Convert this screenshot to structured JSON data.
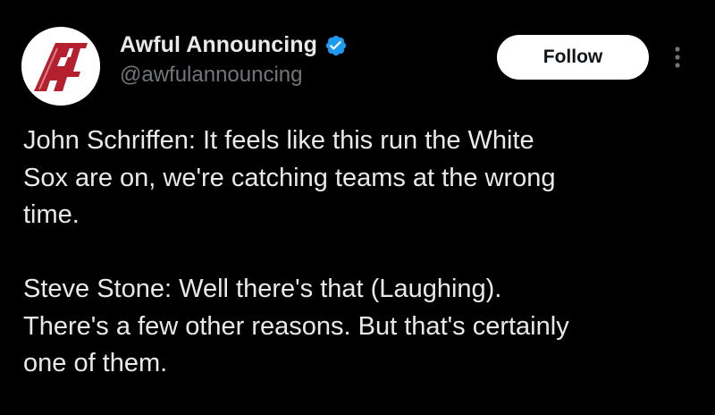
{
  "tweet": {
    "author": {
      "display_name": "Awful Announcing",
      "handle": "@awfulannouncing",
      "verified": true,
      "avatar_icon": "awful-announcing-logo",
      "verified_color": "#1d9bf0"
    },
    "follow_label": "Follow",
    "more_icon": "more-vertical-icon",
    "paragraphs": [
      {
        "lines": [
          "John Schriffen: It feels like this run the White",
          "Sox are on, we're catching teams at the wrong",
          "time."
        ]
      },
      {
        "lines": [
          "Steve Stone: Well there's that (Laughing).",
          "There's a few other reasons. But that's certainly",
          "one of them."
        ]
      }
    ]
  },
  "colors": {
    "background": "#000000",
    "text_primary": "#e7e9ea",
    "text_secondary": "#71767b",
    "brand_red": "#b5202e",
    "follow_bg": "#ffffff"
  }
}
